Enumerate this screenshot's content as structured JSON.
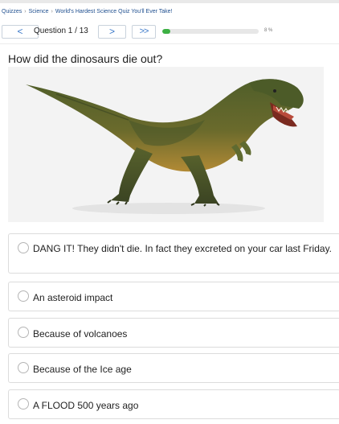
{
  "breadcrumb": {
    "items": [
      "Quizzes",
      "Science",
      "World's Hardest Science Quiz You'll Ever Take!"
    ],
    "separator": "›"
  },
  "nav": {
    "prev_symbol": "<",
    "next_symbol": ">",
    "last_symbol": ">>",
    "question_label": "Question 1 / 13",
    "progress_percent": 8,
    "progress_label": "8 %"
  },
  "question": {
    "text": "How did the dinosaurs die out?",
    "image_icon": "dinosaur-photo"
  },
  "answers": [
    {
      "text": "DANG IT! They didn't die. In fact they excreted on your car last Friday."
    },
    {
      "text": "An asteroid impact"
    },
    {
      "text": "Because of volcanoes"
    },
    {
      "text": "Because of the Ice age"
    },
    {
      "text": "A FLOOD 500 years ago"
    }
  ],
  "colors": {
    "link": "#1f4f8f",
    "nav_button_text": "#3a78c9",
    "progress_fill": "#3cb043",
    "progress_track": "#e7e7e7",
    "border": "#dcdcdc"
  }
}
